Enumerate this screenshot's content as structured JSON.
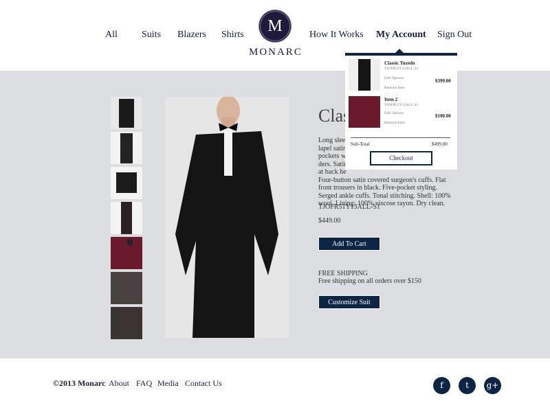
{
  "nav": {
    "items": [
      "All",
      "Suits",
      "Blazers",
      "Shirts",
      "How It Works",
      "My Account",
      "Sign Out"
    ]
  },
  "logo": {
    "monogram": "M",
    "word": "MONARC"
  },
  "product": {
    "title": "Classic Tuxedo",
    "description_lines": [
      "Long sleeve",
      "lapel satin",
      "pockets wi",
      "ders. Satin",
      "at back he",
      "Four-button satin covered surgeon's cuffs. Flat",
      "front trousers in black. Five-pocket styling.",
      "Serged ankle cuffs. Tonal stitching. Shell: 100%",
      "wool. Lining: 100% viscose rayon. Dry clean."
    ],
    "sku": "TJOFR51Y13ALL-S1",
    "price": "$449.00",
    "add_to_cart": "Add To Cart",
    "shipping_title": "FREE SHIPPING",
    "shipping_text": "Free shipping on all orders over $150",
    "customize": "Customize Suit"
  },
  "cart": {
    "items": [
      {
        "name": "Classic Tuxedo",
        "sku": "TJOFR51Y13ALL-S1",
        "edit": "Edit Options",
        "remove": "Remove Item",
        "price": "$399.00"
      },
      {
        "name": "Item 2",
        "sku": "TJOFR51Y13ALL-S1",
        "edit": "Edit Options",
        "remove": "Remove Item",
        "price": "$100.00"
      }
    ],
    "subtotal_label": "Sub-Total",
    "subtotal": "$499.00",
    "checkout": "Checkout"
  },
  "footer": {
    "copyright": "©2013 Monarc",
    "links": [
      "About",
      "FAQ",
      "Media",
      "Contact Us"
    ],
    "social": [
      "facebook-icon",
      "twitter-icon",
      "google-plus-icon"
    ]
  }
}
